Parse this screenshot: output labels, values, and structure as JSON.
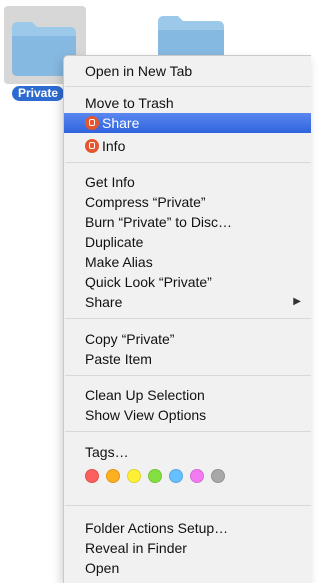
{
  "desktop": {
    "selected_item_label": "Private"
  },
  "menu": {
    "open_in_new_tab": "Open in New Tab",
    "move_to_trash": "Move to Trash",
    "share_service": "Share",
    "info_service": "Info",
    "get_info": "Get Info",
    "compress": "Compress “Private”",
    "burn": "Burn “Private” to Disc…",
    "duplicate": "Duplicate",
    "make_alias": "Make Alias",
    "quick_look": "Quick Look “Private”",
    "share": "Share",
    "copy": "Copy “Private”",
    "paste_item": "Paste Item",
    "clean_up_selection": "Clean Up Selection",
    "show_view_options": "Show View Options",
    "tags": "Tags…",
    "folder_actions_setup": "Folder Actions Setup…",
    "reveal_in_finder": "Reveal in Finder",
    "open": "Open",
    "submenu_arrow": "▶"
  },
  "tag_colors": [
    "#fc605c",
    "#fdaf20",
    "#fef135",
    "#84e040",
    "#66bffe",
    "#f27bf2",
    "#a8a8a8"
  ],
  "colors": {
    "highlight": "#2f63de",
    "service_icon": "#e4572e",
    "folder": "#8fc1e6"
  }
}
